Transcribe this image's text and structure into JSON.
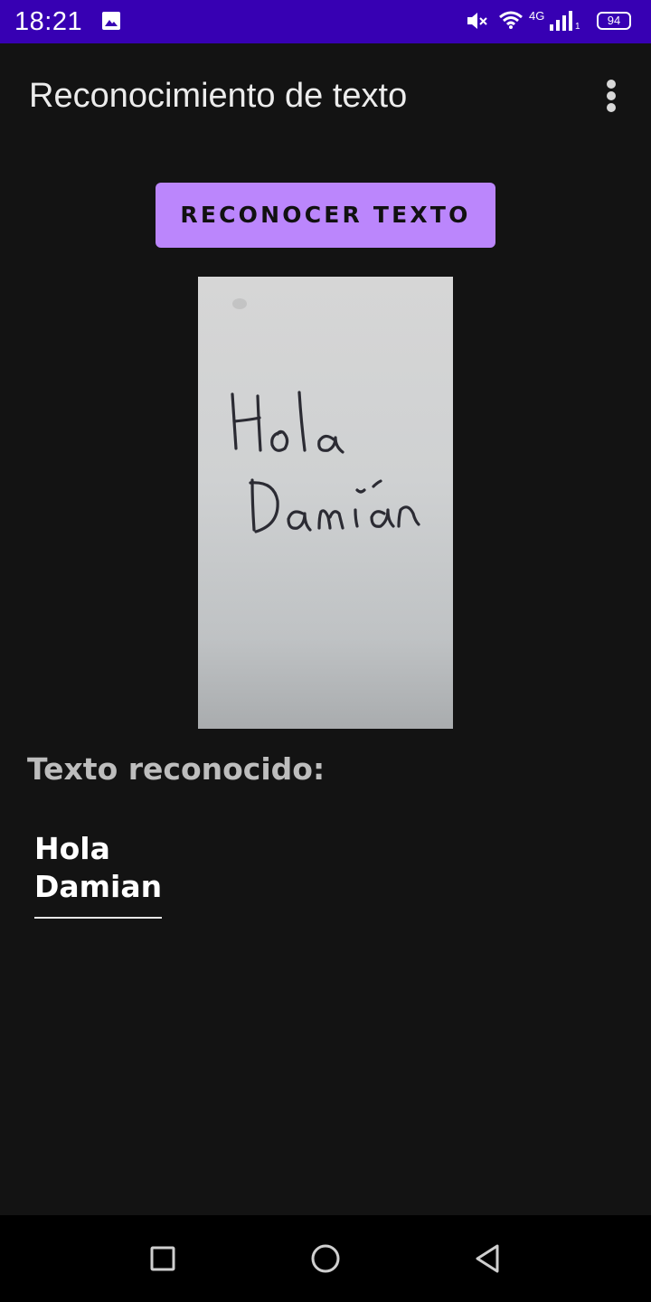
{
  "status_bar": {
    "time": "18:21",
    "network_type": "4G",
    "sim_slot": "1",
    "battery_level": "94",
    "icons": [
      "image-icon",
      "mute-icon",
      "wifi-icon",
      "signal-icon",
      "battery-icon"
    ],
    "background_color": "#3700b3"
  },
  "app_bar": {
    "title": "Reconocimiento de texto",
    "overflow_icon": "more-vert-icon"
  },
  "actions": {
    "recognize_label": "RECONOCER TEXTO",
    "accent_color": "#bb86fc"
  },
  "photo": {
    "handwritten_line_1": "Hola",
    "handwritten_line_2": "Damián"
  },
  "result": {
    "label": "Texto reconocido:",
    "lines": [
      "Hola",
      "Damian"
    ]
  },
  "nav_bar": {
    "icons": [
      "recents-square-icon",
      "home-circle-icon",
      "back-triangle-icon"
    ]
  }
}
